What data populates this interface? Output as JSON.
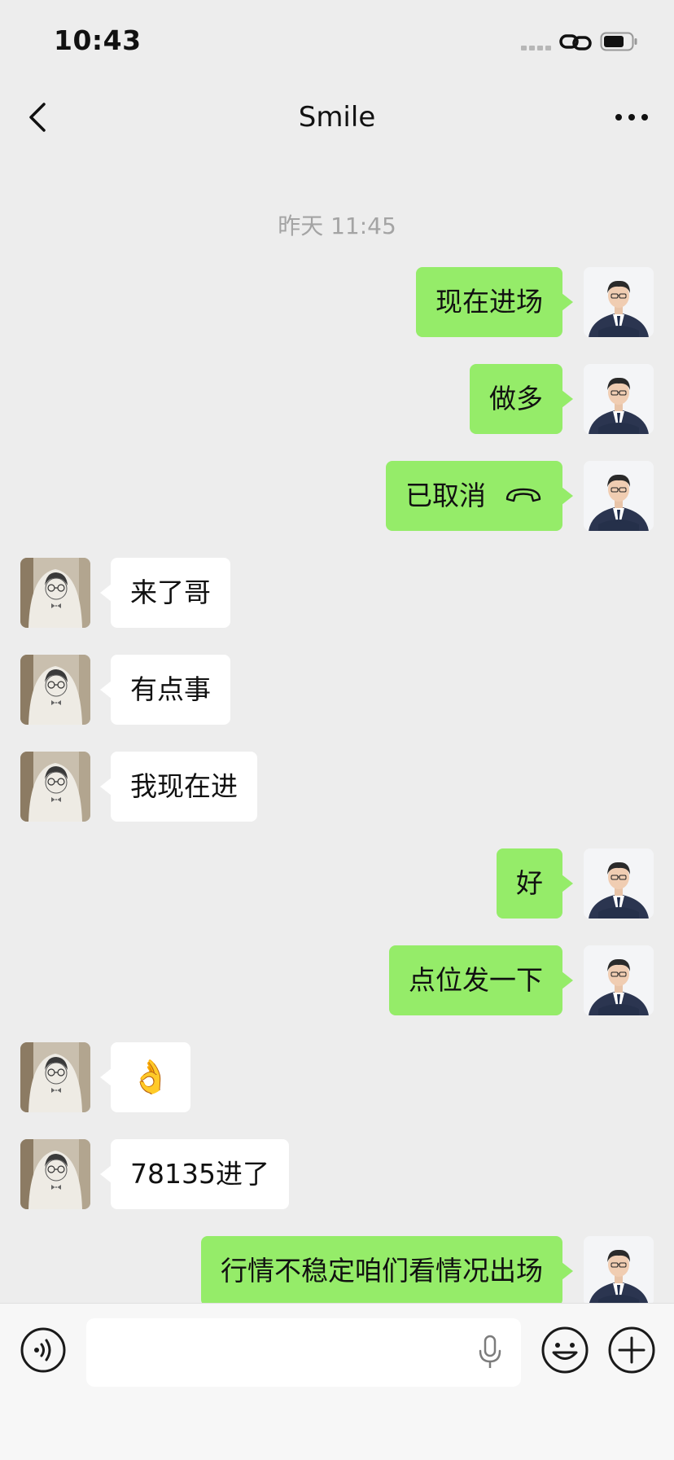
{
  "status_bar": {
    "time": "10:43"
  },
  "nav": {
    "title": "Smile"
  },
  "chat": {
    "timestamp": "昨天 11:45",
    "messages": [
      {
        "sender": "me",
        "text": "现在进场"
      },
      {
        "sender": "me",
        "text": "做多"
      },
      {
        "sender": "me",
        "text": "已取消",
        "icon": "phone-hangup-icon"
      },
      {
        "sender": "other",
        "text": "来了哥"
      },
      {
        "sender": "other",
        "text": "有点事"
      },
      {
        "sender": "other",
        "text": "我现在进"
      },
      {
        "sender": "me",
        "text": "好"
      },
      {
        "sender": "me",
        "text": "点位发一下"
      },
      {
        "sender": "other",
        "text": "👌"
      },
      {
        "sender": "other",
        "text": "78135进了"
      },
      {
        "sender": "me",
        "text": "行情不稳定咱们看情况出场"
      }
    ]
  },
  "input_bar": {
    "value": "",
    "placeholder": ""
  },
  "colors": {
    "background": "#ededed",
    "my_bubble": "#95ec69",
    "other_bubble": "#ffffff",
    "timestamp": "#a4a4a4"
  }
}
